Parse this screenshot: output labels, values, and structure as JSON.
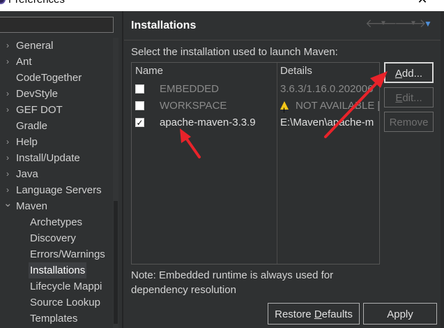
{
  "window": {
    "title": "Preferences"
  },
  "tree": {
    "items": [
      {
        "label": "General",
        "expandable": true
      },
      {
        "label": "Ant",
        "expandable": true
      },
      {
        "label": "CodeTogether",
        "expandable": false
      },
      {
        "label": "DevStyle",
        "expandable": true
      },
      {
        "label": "GEF DOT",
        "expandable": true
      },
      {
        "label": "Gradle",
        "expandable": false
      },
      {
        "label": "Help",
        "expandable": true
      },
      {
        "label": "Install/Update",
        "expandable": true
      },
      {
        "label": "Java",
        "expandable": true
      },
      {
        "label": "Language Servers",
        "expandable": true
      },
      {
        "label": "Maven",
        "expandable": true,
        "expanded": true
      },
      {
        "label": "Archetypes",
        "child": true
      },
      {
        "label": "Discovery",
        "child": true
      },
      {
        "label": "Errors/Warnings",
        "child": true
      },
      {
        "label": "Installations",
        "child": true,
        "selected": true
      },
      {
        "label": "Lifecycle Mappi",
        "child": true
      },
      {
        "label": "Source Lookup",
        "child": true
      },
      {
        "label": "Templates",
        "child": true
      }
    ]
  },
  "page": {
    "title": "Installations",
    "instruction": "Select the installation used to launch Maven:",
    "columns": {
      "name": "Name",
      "details": "Details"
    },
    "rows": [
      {
        "checked": false,
        "name": "EMBEDDED",
        "details": "3.6.3/1.16.0.202006",
        "dim": true,
        "warning": false
      },
      {
        "checked": false,
        "name": "WORKSPACE",
        "details": "NOT AVAILABLE [",
        "dim": true,
        "warning": true
      },
      {
        "checked": true,
        "name": "apache-maven-3.3.9",
        "details": "E:\\Maven\\apache-m",
        "dim": false,
        "warning": false
      }
    ],
    "buttons": {
      "add": "Add...",
      "edit": "Edit...",
      "remove": "Remove"
    },
    "note": "Note: Embedded runtime is always used for dependency resolution",
    "restore_defaults": "Restore Defaults",
    "apply": "Apply"
  },
  "colors": {
    "background": "#2f3132",
    "accent": "#4f8ed6",
    "annotation": "#e8232a",
    "warning": "#f5c518"
  }
}
